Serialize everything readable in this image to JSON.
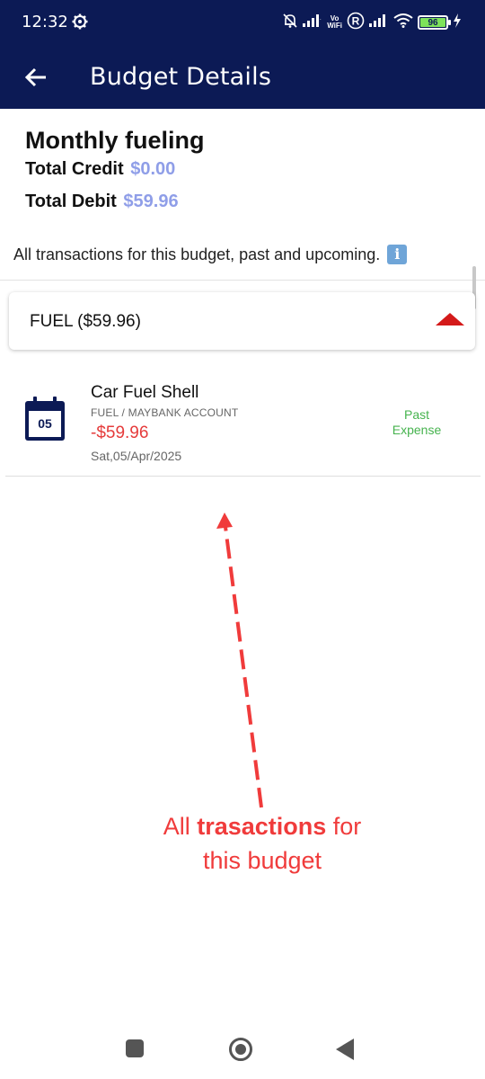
{
  "status_bar": {
    "time": "12:32",
    "battery": "96",
    "vowifi_top": "Vo",
    "vowifi_bottom": "WiFi",
    "r_badge": "R"
  },
  "app_bar": {
    "title": "Budget Details",
    "back_icon": "arrow-left-icon"
  },
  "budget": {
    "name": "Monthly fueling",
    "total_credit_label": "Total Credit",
    "total_credit_value": "$0.00",
    "total_debit_label": "Total Debit",
    "total_debit_value": "$59.96",
    "description": "All transactions for this budget, past and upcoming."
  },
  "category": {
    "label": "FUEL ($59.96)",
    "expanded": true
  },
  "transactions": [
    {
      "name": "Car Fuel Shell",
      "subtitle": "FUEL / MAYBANK ACCOUNT",
      "amount": "-$59.96",
      "date": "Sat,05/Apr/2025",
      "day": "05",
      "status_line1": "Past",
      "status_line2": "Expense"
    }
  ],
  "annotation": {
    "prefix": "All ",
    "bold": "trasactions",
    "suffix": " for",
    "line2": "this budget"
  },
  "colors": {
    "app_bar": "#0c1a55",
    "amount_blue": "#8f9ee8",
    "expense_red": "#e53b3b",
    "caret_red": "#d41a1a",
    "status_green": "#46b34e",
    "annotation_red": "#f03b3b"
  }
}
